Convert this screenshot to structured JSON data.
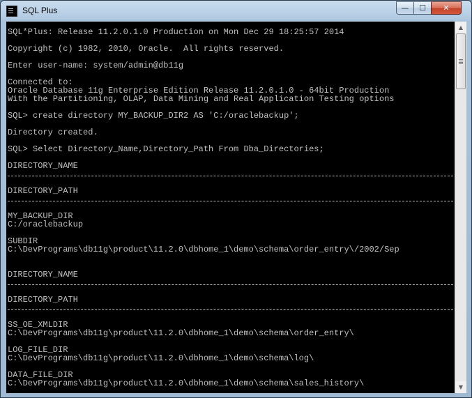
{
  "window": {
    "title": "SQL Plus",
    "caption": {
      "minimize": "—",
      "maximize": "☐",
      "close": "✕"
    },
    "scroll": {
      "up": "▲",
      "down": "▼"
    }
  },
  "console": {
    "lines": [
      {
        "type": "text",
        "text": "SQL*Plus: Release 11.2.0.1.0 Production on Mon Dec 29 18:25:57 2014"
      },
      {
        "type": "blank"
      },
      {
        "type": "text",
        "text": "Copyright (c) 1982, 2010, Oracle.  All rights reserved."
      },
      {
        "type": "blank"
      },
      {
        "type": "text",
        "text": "Enter user-name: system/admin@db11g"
      },
      {
        "type": "blank"
      },
      {
        "type": "text",
        "text": "Connected to:"
      },
      {
        "type": "text",
        "text": "Oracle Database 11g Enterprise Edition Release 11.2.0.1.0 - 64bit Production"
      },
      {
        "type": "text",
        "text": "With the Partitioning, OLAP, Data Mining and Real Application Testing options"
      },
      {
        "type": "blank"
      },
      {
        "type": "text",
        "text": "SQL> create directory MY_BACKUP_DIR2 AS 'C:/oraclebackup';"
      },
      {
        "type": "blank"
      },
      {
        "type": "text",
        "text": "Directory created."
      },
      {
        "type": "blank"
      },
      {
        "type": "text",
        "text": "SQL> Select Directory_Name,Directory_Path From Dba_Directories;"
      },
      {
        "type": "blank"
      },
      {
        "type": "text",
        "text": "DIRECTORY_NAME"
      },
      {
        "type": "separator"
      },
      {
        "type": "blank"
      },
      {
        "type": "text",
        "text": "DIRECTORY_PATH"
      },
      {
        "type": "separator"
      },
      {
        "type": "blank"
      },
      {
        "type": "text",
        "text": "MY_BACKUP_DIR"
      },
      {
        "type": "text",
        "text": "C:/oraclebackup"
      },
      {
        "type": "blank"
      },
      {
        "type": "text",
        "text": "SUBDIR"
      },
      {
        "type": "text",
        "text": "C:\\DevPrograms\\db11g\\product\\11.2.0\\dbhome_1\\demo\\schema\\order_entry\\/2002/Sep"
      },
      {
        "type": "blank"
      },
      {
        "type": "blank"
      },
      {
        "type": "text",
        "text": "DIRECTORY_NAME"
      },
      {
        "type": "separator"
      },
      {
        "type": "blank"
      },
      {
        "type": "text",
        "text": "DIRECTORY_PATH"
      },
      {
        "type": "separator"
      },
      {
        "type": "blank"
      },
      {
        "type": "text",
        "text": "SS_OE_XMLDIR"
      },
      {
        "type": "text",
        "text": "C:\\DevPrograms\\db11g\\product\\11.2.0\\dbhome_1\\demo\\schema\\order_entry\\"
      },
      {
        "type": "blank"
      },
      {
        "type": "text",
        "text": "LOG_FILE_DIR"
      },
      {
        "type": "text",
        "text": "C:\\DevPrograms\\db11g\\product\\11.2.0\\dbhome_1\\demo\\schema\\log\\"
      },
      {
        "type": "blank"
      },
      {
        "type": "text",
        "text": "DATA_FILE_DIR"
      },
      {
        "type": "text",
        "text": "C:\\DevPrograms\\db11g\\product\\11.2.0\\dbhome_1\\demo\\schema\\sales_history\\"
      }
    ]
  },
  "colors": {
    "console_bg": "#000000",
    "console_fg": "#c0c0c0",
    "close_button": "#c3432a"
  }
}
